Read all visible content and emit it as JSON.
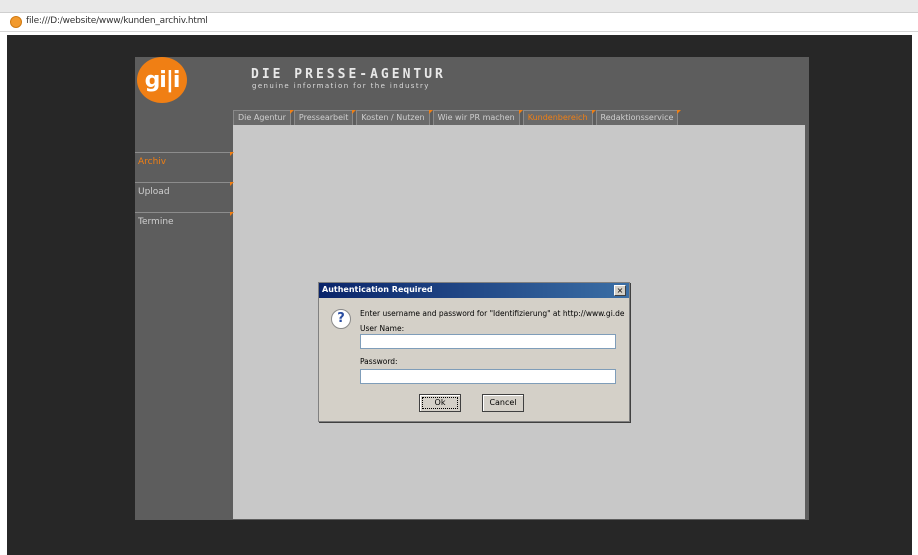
{
  "browser": {
    "url": "file:///D:/website/www/kunden_archiv.html"
  },
  "site": {
    "logo_text": "gi|i",
    "title": "DIE PRESSE-AGENTUR",
    "subtitle": "genuine information for the industry"
  },
  "tabs": [
    {
      "label": "Die Agentur"
    },
    {
      "label": "Pressearbeit"
    },
    {
      "label": "Kosten / Nutzen"
    },
    {
      "label": "Wie wir PR machen"
    },
    {
      "label": "Kundenbereich"
    },
    {
      "label": "Redaktionsservice"
    }
  ],
  "sidebar": {
    "items": [
      {
        "label": "Archiv"
      },
      {
        "label": "Upload"
      },
      {
        "label": "Termine"
      }
    ]
  },
  "dialog": {
    "title": "Authentication Required",
    "close_glyph": "×",
    "icon_glyph": "?",
    "message": "Enter username and password for \"Identifizierung\" at http://www.gi.de",
    "username_label": "User Name:",
    "username_value": "",
    "password_label": "Password:",
    "password_value": "",
    "ok_label": "Ok",
    "cancel_label": "Cancel"
  },
  "colors": {
    "accent": "#f07f14",
    "frame": "#5d5d5d",
    "content": "#c8c8c8",
    "backdrop": "#272727",
    "dialog_titlebar": "#0a246a"
  }
}
